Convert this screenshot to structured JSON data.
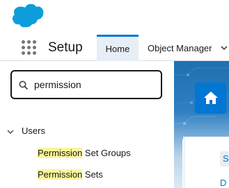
{
  "brand": {
    "logo_icon": "salesforce-cloud-logo",
    "logo_color": "#0d9dda"
  },
  "nav": {
    "app_name": "Setup",
    "tabs": [
      {
        "label": "Home",
        "active": true
      },
      {
        "label": "Object Manager",
        "active": false
      }
    ]
  },
  "sidebar": {
    "search": {
      "value": "permission",
      "placeholder": "Quick Find"
    },
    "tree": {
      "group_label": "Users",
      "items": [
        {
          "highlight": "Permission",
          "rest": " Set Groups"
        },
        {
          "highlight": "Permission",
          "rest": " Sets"
        }
      ]
    }
  },
  "main": {
    "home_icon": "home-icon",
    "chip_text": "S",
    "partial_text": "D"
  },
  "colors": {
    "accent": "#0176d3",
    "highlight": "#fbf59b",
    "active_tab_bg": "#e7eef5"
  }
}
